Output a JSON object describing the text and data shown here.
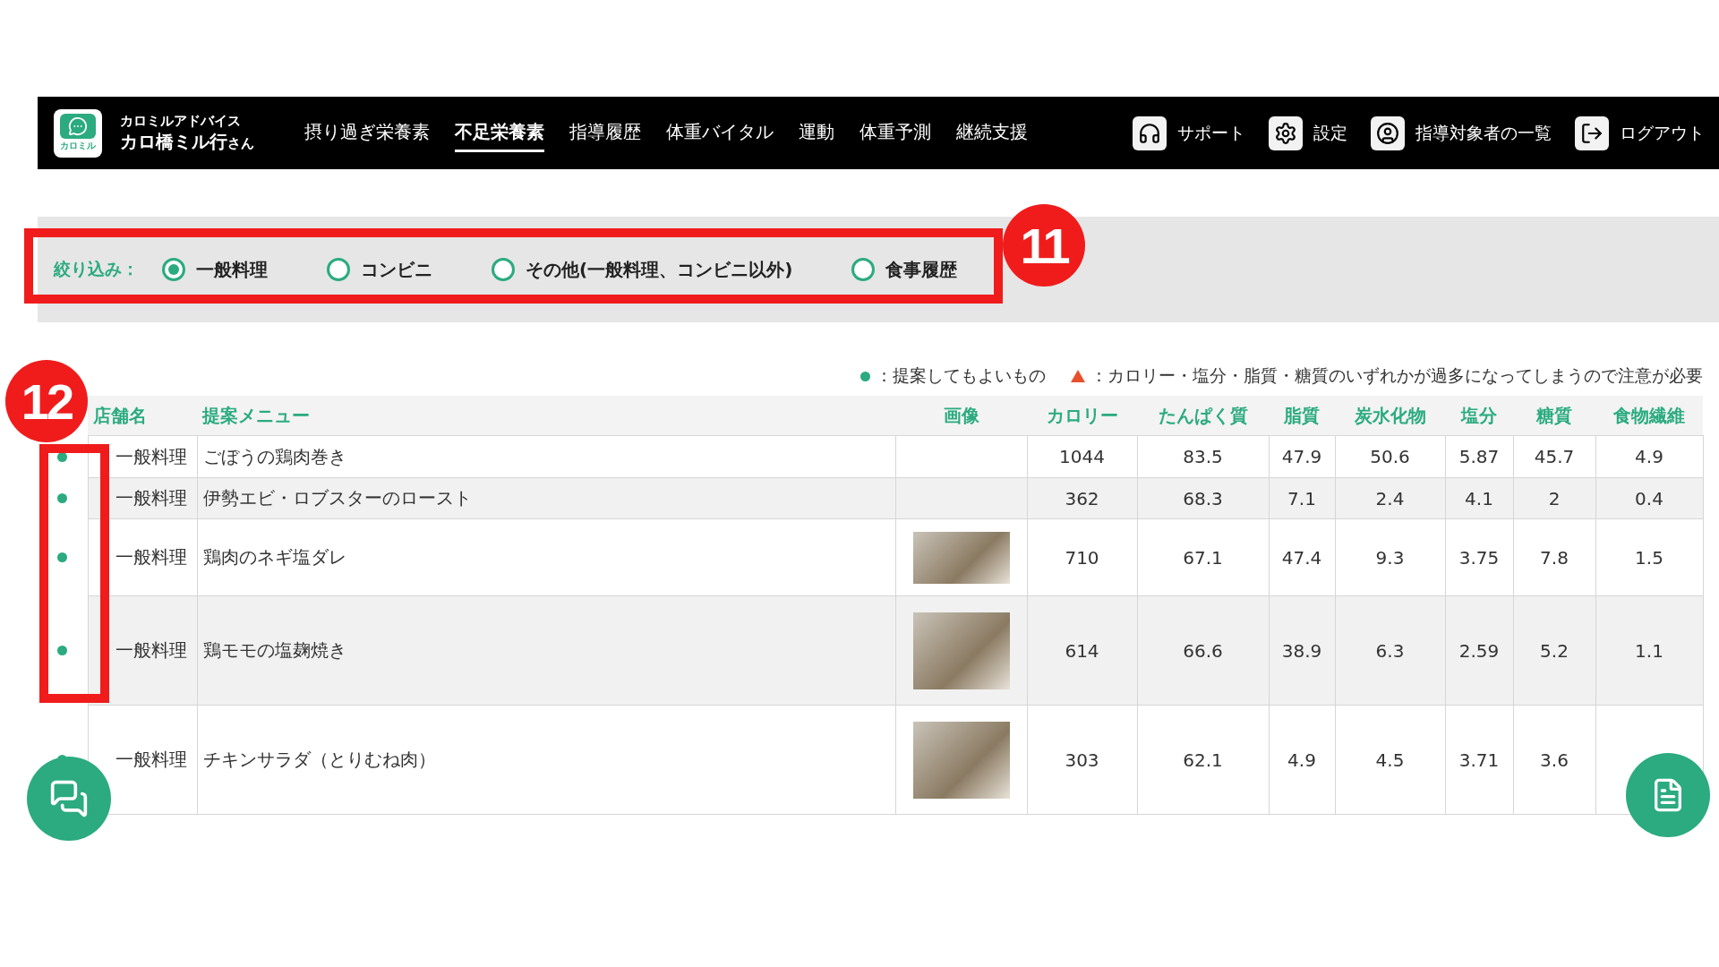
{
  "header": {
    "app_name": "カロミルアドバイス",
    "logo_text": "カロミル",
    "user": "カロ橋ミル行",
    "user_suffix": "さん",
    "nav": [
      {
        "label": "摂り過ぎ栄養素",
        "selected": false
      },
      {
        "label": "不足栄養素",
        "selected": true
      },
      {
        "label": "指導履歴",
        "selected": false
      },
      {
        "label": "体重バイタル",
        "selected": false
      },
      {
        "label": "運動",
        "selected": false
      },
      {
        "label": "体重予測",
        "selected": false
      },
      {
        "label": "継続支援",
        "selected": false
      }
    ],
    "actions": [
      {
        "kind": "support",
        "label": "サポート"
      },
      {
        "kind": "settings",
        "label": "設定"
      },
      {
        "kind": "users",
        "label": "指導対象者の一覧"
      },
      {
        "kind": "logout",
        "label": "ログアウト"
      }
    ]
  },
  "filter": {
    "label": "絞り込み：",
    "options": [
      {
        "label": "一般料理",
        "selected": true
      },
      {
        "label": "コンビニ",
        "selected": false
      },
      {
        "label": "その他(一般料理、コンビニ以外)",
        "selected": false
      },
      {
        "label": "食事履歴",
        "selected": false
      }
    ]
  },
  "legend": [
    {
      "kind": "suggested",
      "text": "：提案してもよいもの"
    },
    {
      "kind": "caution",
      "text": "：カロリー・塩分・脂質・糖質のいずれかが過多になってしまうので注意が必要"
    }
  ],
  "table": {
    "columns": [
      "店舗名",
      "提案メニュー",
      "画像",
      "カロリー",
      "たんぱく質",
      "脂質",
      "炭水化物",
      "塩分",
      "糖質",
      "食物繊維"
    ],
    "rows": [
      {
        "kind": "suggested",
        "shop": "一般料理",
        "menu": "ごぼうの鶏肉巻き",
        "has_image": false,
        "values": [
          "1044",
          "83.5",
          "47.9",
          "50.6",
          "5.87",
          "45.7",
          "4.9"
        ]
      },
      {
        "kind": "suggested",
        "shop": "一般料理",
        "menu": "伊勢エビ・ロブスターのロースト",
        "has_image": false,
        "values": [
          "362",
          "68.3",
          "7.1",
          "2.4",
          "4.1",
          "2",
          "0.4"
        ]
      },
      {
        "kind": "suggested",
        "shop": "一般料理",
        "menu": "鶏肉のネギ塩ダレ",
        "has_image": true,
        "values": [
          "710",
          "67.1",
          "47.4",
          "9.3",
          "3.75",
          "7.8",
          "1.5"
        ]
      },
      {
        "kind": "suggested",
        "shop": "一般料理",
        "menu": "鶏モモの塩麹焼き",
        "has_image": true,
        "values": [
          "614",
          "66.6",
          "38.9",
          "6.3",
          "2.59",
          "5.2",
          "1.1"
        ]
      },
      {
        "kind": "suggested",
        "shop": "一般料理",
        "menu": "チキンサラダ（とりむね肉）",
        "has_image": true,
        "values": [
          "303",
          "62.1",
          "4.9",
          "4.5",
          "3.71",
          "3.6"
        ]
      }
    ]
  },
  "annotations": [
    {
      "number": "11"
    },
    {
      "number": "12"
    }
  ]
}
